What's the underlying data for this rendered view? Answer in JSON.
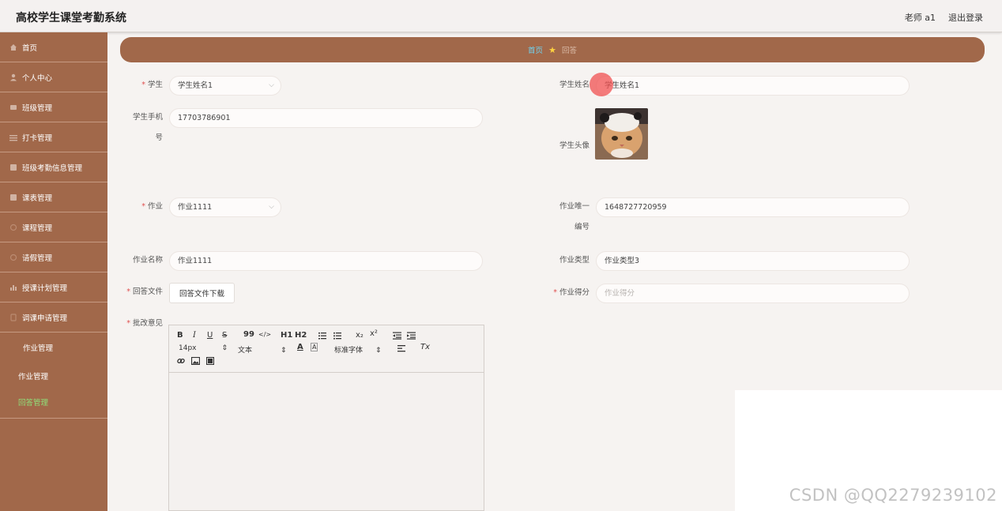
{
  "header": {
    "title": "高校学生课堂考勤系统",
    "user": "老师 a1",
    "logout": "退出登录"
  },
  "sidebar": {
    "items": [
      {
        "label": "首页",
        "icon": "home-icon"
      },
      {
        "label": "个人中心",
        "icon": "user-icon"
      },
      {
        "label": "班级管理",
        "icon": "class-icon"
      },
      {
        "label": "打卡管理",
        "icon": "checkin-icon"
      },
      {
        "label": "班级考勤信息管理",
        "icon": "attendance-icon"
      },
      {
        "label": "课表管理",
        "icon": "timetable-icon"
      },
      {
        "label": "课程管理",
        "icon": "course-icon"
      },
      {
        "label": "请假管理",
        "icon": "leave-icon"
      },
      {
        "label": "授课计划管理",
        "icon": "chart-icon"
      },
      {
        "label": "调课申请管理",
        "icon": "swap-icon"
      }
    ],
    "sub_group": "作业管理",
    "sub_items": [
      "作业管理",
      "回答管理"
    ],
    "active": "回答管理"
  },
  "breadcrumb": {
    "home": "首页",
    "current": "回答"
  },
  "form": {
    "student_label": "学生",
    "student_value": "学生姓名1",
    "student_name_label": "学生姓名",
    "student_name_value": "学生姓名1",
    "phone_label_1": "学生手机",
    "phone_label_2": "号",
    "phone_value": "17703786901",
    "avatar_label": "学生头像",
    "homework_label": "作业",
    "homework_value": "作业1111",
    "homework_id_label_1": "作业唯一",
    "homework_id_label_2": "编号",
    "homework_id_value": "1648727720959",
    "homework_name_label": "作业名称",
    "homework_name_value": "作业1111",
    "homework_type_label": "作业类型",
    "homework_type_value": "作业类型3",
    "answer_file_label": "回答文件",
    "answer_file_button": "回答文件下载",
    "score_label": "作业得分",
    "score_placeholder": "作业得分",
    "comment_label": "批改意见"
  },
  "editor": {
    "font_size": "14px",
    "text_style": "文本",
    "font_family": "标准字体",
    "btn_bold": "B",
    "btn_italic": "I",
    "btn_underline": "U",
    "btn_strike": "S",
    "btn_quote": "99",
    "btn_code": "</>",
    "btn_h1": "H1",
    "btn_h2": "H2",
    "btn_sub": "x₂",
    "btn_sup": "x²",
    "btn_color": "A",
    "btn_bg": "A",
    "btn_clear": "Tx"
  },
  "watermark": "CSDN @QQ2279239102",
  "colors": {
    "sidebar": "#a1684a",
    "active": "#8fe07a",
    "crumb_home": "#6fd3f0",
    "required": "#e05050"
  }
}
